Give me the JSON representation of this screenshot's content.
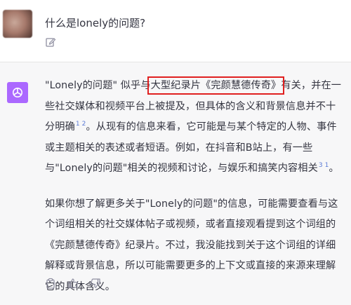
{
  "user": {
    "question": "什么是lonely的问题?"
  },
  "answer": {
    "p1_a": "\"Lonely的问题\" 似乎与",
    "p1_highlight": "大型纪录片《完颜慧德传奇》",
    "p1_b": "有关，并在一些社交媒体和视频平台上被提及，但具体的含义和背景信息并不十分明确",
    "p1_sup1": "1 2",
    "p1_c": "。从现有的信息来看，它可能是与某个特定的人物、事件或主题相关的表述或者短语。例如，在抖音和B站上，有一些与\"Lonely的问题\"相关的视频和讨论，与娱乐和搞笑内容相关",
    "p1_sup2": "3 1",
    "p1_d": "。",
    "p2": "如果你想了解更多关于\"Lonely的问题\"的信息，可能需要查看与这个词组相关的社交媒体帖子或视频，或者直接观看提到这个词组的《完颜慧德传奇》纪录片。不过，我没能找到关于这个词组的详细解释或背景信息，所以可能需要更多的上下文或直接的来源来理解它的具体含义。"
  },
  "icons": {
    "user_avatar": "blurred-photo",
    "edit": "edit-icon",
    "bot": "openai-logo-icon",
    "copy": "clipboard-icon",
    "like": "thumbs-up-icon",
    "dislike": "thumbs-down-icon"
  },
  "colors": {
    "bot_avatar": "#ab68ff",
    "highlight_box": "#e02020",
    "citation": "#5b7bd5"
  }
}
